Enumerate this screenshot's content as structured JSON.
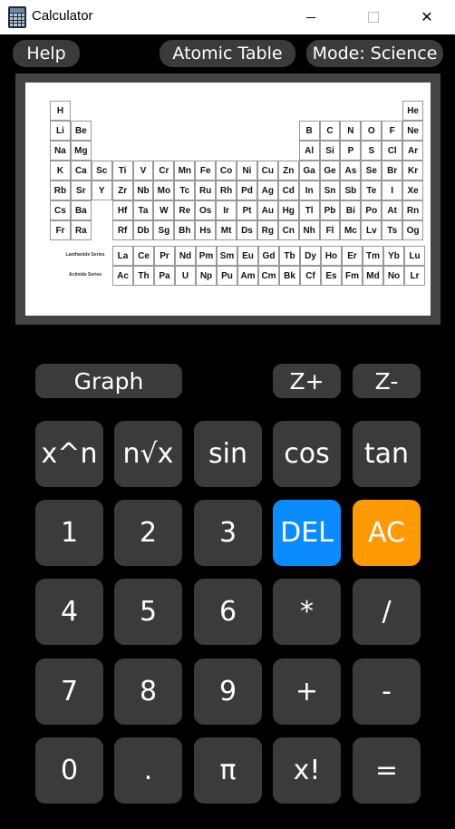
{
  "window": {
    "title": "Calculator",
    "close_glyph": "✕"
  },
  "menu": {
    "help": "Help",
    "atomic_table": "Atomic Table",
    "mode": "Mode: Science"
  },
  "periodic_table": {
    "main": [
      [
        "H",
        "",
        "",
        "",
        "",
        "",
        "",
        "",
        "",
        "",
        "",
        "",
        "",
        "",
        "",
        "",
        "",
        "He"
      ],
      [
        "Li",
        "Be",
        "",
        "",
        "",
        "",
        "",
        "",
        "",
        "",
        "",
        "",
        "B",
        "C",
        "N",
        "O",
        "F",
        "Ne"
      ],
      [
        "Na",
        "Mg",
        "",
        "",
        "",
        "",
        "",
        "",
        "",
        "",
        "",
        "",
        "Al",
        "Si",
        "P",
        "S",
        "Cl",
        "Ar"
      ],
      [
        "K",
        "Ca",
        "Sc",
        "Ti",
        "V",
        "Cr",
        "Mn",
        "Fe",
        "Co",
        "Ni",
        "Cu",
        "Zn",
        "Ga",
        "Ge",
        "As",
        "Se",
        "Br",
        "Kr"
      ],
      [
        "Rb",
        "Sr",
        "Y",
        "Zr",
        "Nb",
        "Mo",
        "Tc",
        "Ru",
        "Rh",
        "Pd",
        "Ag",
        "Cd",
        "In",
        "Sn",
        "Sb",
        "Te",
        "I",
        "Xe"
      ],
      [
        "Cs",
        "Ba",
        "",
        "Hf",
        "Ta",
        "W",
        "Re",
        "Os",
        "Ir",
        "Pt",
        "Au",
        "Hg",
        "Tl",
        "Pb",
        "Bi",
        "Po",
        "At",
        "Rn"
      ],
      [
        "Fr",
        "Ra",
        "",
        "Rf",
        "Db",
        "Sg",
        "Bh",
        "Hs",
        "Mt",
        "Ds",
        "Rg",
        "Cn",
        "Nh",
        "Fl",
        "Mc",
        "Lv",
        "Ts",
        "Og"
      ]
    ],
    "lanthanides": [
      "La",
      "Ce",
      "Pr",
      "Nd",
      "Pm",
      "Sm",
      "Eu",
      "Gd",
      "Tb",
      "Dy",
      "Ho",
      "Er",
      "Tm",
      "Yb",
      "Lu"
    ],
    "actinides": [
      "Ac",
      "Th",
      "Pa",
      "U",
      "Np",
      "Pu",
      "Am",
      "Cm",
      "Bk",
      "Cf",
      "Es",
      "Fm",
      "Md",
      "No",
      "Lr"
    ],
    "lanthanide_label": "Lanthanide Series",
    "actinide_label": "Actinide Series"
  },
  "controls": {
    "graph": "Graph",
    "zoom_in": "Z+",
    "zoom_out": "Z-"
  },
  "keypad": [
    [
      "x^n",
      "n√x",
      "sin",
      "cos",
      "tan"
    ],
    [
      "1",
      "2",
      "3",
      "DEL",
      "AC"
    ],
    [
      "4",
      "5",
      "6",
      "*",
      "/"
    ],
    [
      "7",
      "8",
      "9",
      "+",
      "-"
    ],
    [
      "0",
      ".",
      "π",
      "x!",
      "="
    ]
  ],
  "colors": {
    "key_bg": "#3b3b3b",
    "del_bg": "#0a8cff",
    "ac_bg": "#ff9a05",
    "background": "#000000"
  }
}
